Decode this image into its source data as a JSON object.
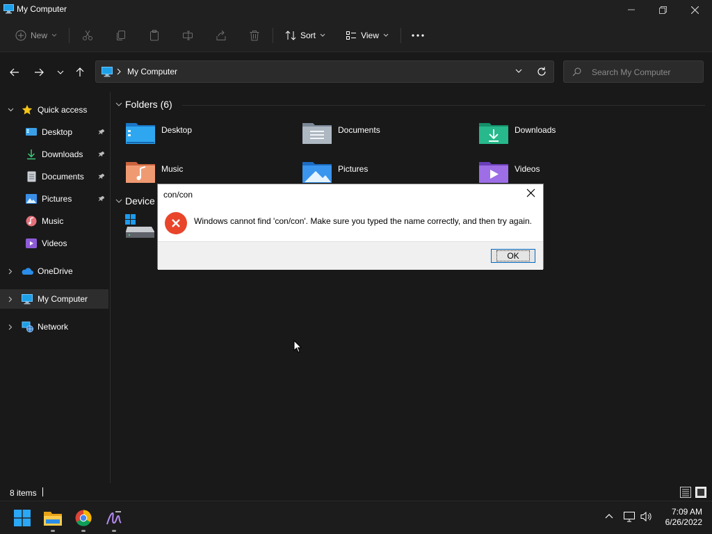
{
  "window": {
    "title": "My Computer"
  },
  "toolbar": {
    "new_label": "New",
    "sort_label": "Sort",
    "view_label": "View"
  },
  "address": {
    "path": "My Computer",
    "search_placeholder": "Search My Computer"
  },
  "sidebar": {
    "quick_access": "Quick access",
    "quick_items": [
      {
        "label": "Desktop",
        "pinned": true
      },
      {
        "label": "Downloads",
        "pinned": true
      },
      {
        "label": "Documents",
        "pinned": true
      },
      {
        "label": "Pictures",
        "pinned": true
      },
      {
        "label": "Music",
        "pinned": false
      },
      {
        "label": "Videos",
        "pinned": false
      }
    ],
    "onedrive": "OneDrive",
    "my_computer": "My Computer",
    "network": "Network"
  },
  "content": {
    "folders_header": "Folders (6)",
    "folders": [
      "Desktop",
      "Documents",
      "Downloads",
      "Music",
      "Pictures",
      "Videos"
    ],
    "devices_header": "Device"
  },
  "status": {
    "items": "8 items"
  },
  "dialog": {
    "title": "con/con",
    "message": "Windows cannot find 'con/con'. Make sure you typed the name correctly, and then try again.",
    "ok": "OK"
  },
  "taskbar": {
    "time": "7:09 AM",
    "date": "6/26/2022"
  },
  "colors": {
    "accent": "#0067c0",
    "error": "#e8452b",
    "dark_bg": "#191919"
  }
}
